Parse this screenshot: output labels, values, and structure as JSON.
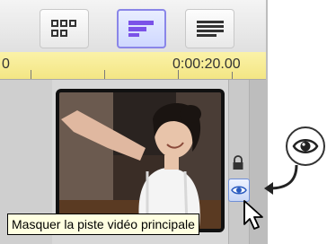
{
  "toolbar": {
    "buttons": [
      {
        "icon": "storyboard-grid-icon",
        "active": false
      },
      {
        "icon": "timeline-bars-icon",
        "active": true
      },
      {
        "icon": "list-lines-icon",
        "active": false
      }
    ]
  },
  "ruler": {
    "start_label": "0",
    "end_label": "0:00:20.00"
  },
  "track": {
    "lock_icon": "lock-icon",
    "eye_icon": "eye-icon"
  },
  "tooltip": {
    "text": "Masquer la piste vidéo principale"
  },
  "callout": {
    "icon": "eye-icon"
  },
  "colors": {
    "active_button_border": "#8a86e8",
    "active_icon": "#7b52e8",
    "ruler_bg": "#f3e684",
    "tooltip_bg": "#ffffe1",
    "eye_button_border": "#6f8fd6"
  }
}
